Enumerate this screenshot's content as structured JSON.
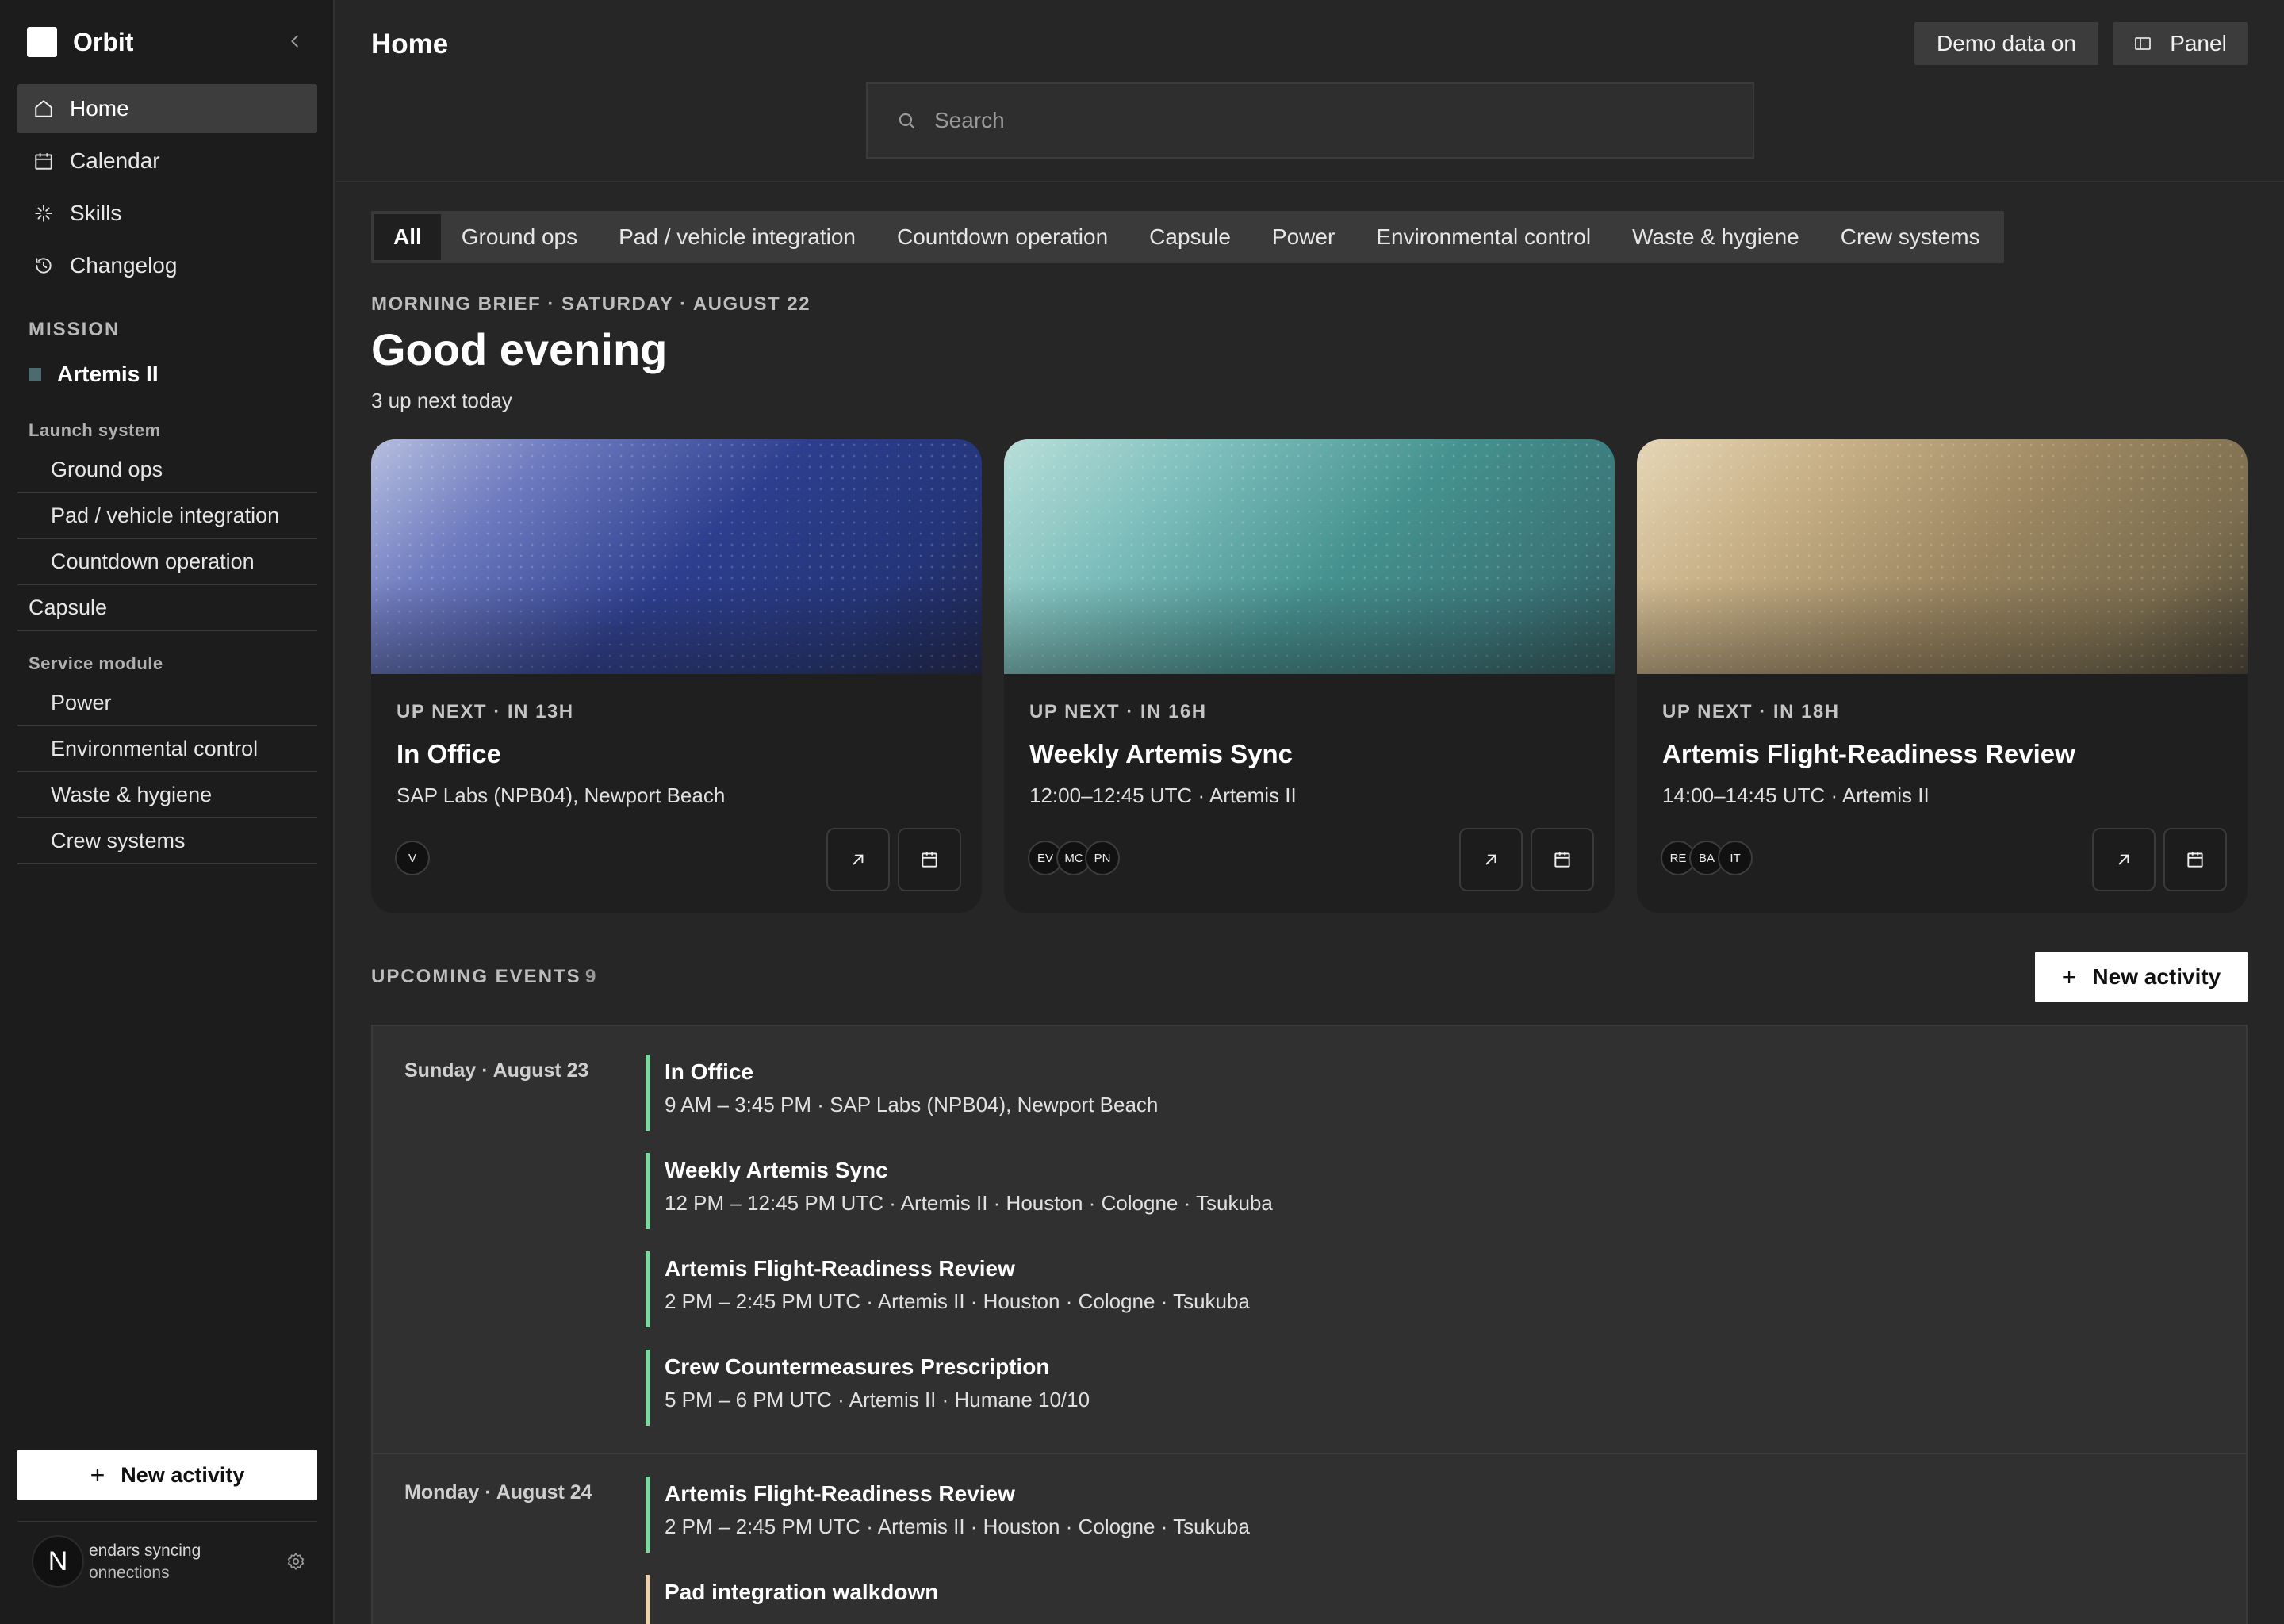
{
  "app": {
    "name": "Orbit"
  },
  "sidebar": {
    "nav": [
      {
        "label": "Home",
        "icon": "home-icon",
        "active": true
      },
      {
        "label": "Calendar",
        "icon": "calendar-icon",
        "active": false
      },
      {
        "label": "Skills",
        "icon": "skills-icon",
        "active": false
      },
      {
        "label": "Changelog",
        "icon": "history-icon",
        "active": false
      }
    ],
    "mission_label": "MISSION",
    "mission": {
      "name": "Artemis II",
      "color": "#4d6b6f"
    },
    "groups": [
      {
        "label": "Launch system",
        "items": [
          "Ground ops",
          "Pad / vehicle integration",
          "Countdown operation"
        ]
      },
      {
        "label": "Capsule",
        "items": []
      },
      {
        "label": "Service module",
        "items": [
          "Power",
          "Environmental control",
          "Waste & hygiene",
          "Crew systems"
        ]
      }
    ],
    "new_activity": "New activity",
    "sync": {
      "avatar_letter": "N",
      "line1": "endars syncing",
      "line2": "onnections"
    }
  },
  "header": {
    "title": "Home",
    "demo_button": "Demo data on",
    "panel_button": "Panel",
    "search_placeholder": "Search"
  },
  "tabs": [
    "All",
    "Ground ops",
    "Pad / vehicle integration",
    "Countdown operation",
    "Capsule",
    "Power",
    "Environmental control",
    "Waste & hygiene",
    "Crew systems"
  ],
  "active_tab": "All",
  "brief": {
    "label": "MORNING BRIEF · SATURDAY · AUGUST 22",
    "greeting": "Good evening",
    "summary": "3 up next today"
  },
  "cards": [
    {
      "kicker": "UP NEXT · IN 13H",
      "title": "In Office",
      "sub": "SAP Labs (NPB04), Newport Beach",
      "avatars": [
        "V"
      ],
      "theme": "navy"
    },
    {
      "kicker": "UP NEXT · IN 16H",
      "title": "Weekly Artemis Sync",
      "sub": "12:00–12:45 UTC · Artemis II",
      "avatars": [
        "EV",
        "MC",
        "PN"
      ],
      "theme": "teal"
    },
    {
      "kicker": "UP NEXT · IN 18H",
      "title": "Artemis Flight-Readiness Review",
      "sub": "14:00–14:45 UTC · Artemis II",
      "avatars": [
        "RE",
        "BA",
        "IT"
      ],
      "theme": "gold"
    }
  ],
  "upcoming": {
    "label": "UPCOMING EVENTS",
    "count": "9",
    "new_activity": "New activity",
    "days": [
      {
        "label": "Sunday · August 23",
        "events": [
          {
            "title": "In Office",
            "meta": "9 AM – 3:45 PM · SAP Labs (NPB04), Newport Beach",
            "color": "#7ed6a0"
          },
          {
            "title": "Weekly Artemis Sync",
            "meta": "12 PM – 12:45 PM UTC · Artemis II · Houston · Cologne · Tsukuba",
            "color": "#7ed6a0"
          },
          {
            "title": "Artemis Flight-Readiness Review",
            "meta": "2 PM – 2:45 PM UTC · Artemis II · Houston · Cologne · Tsukuba",
            "color": "#7ed6a0"
          },
          {
            "title": "Crew Countermeasures Prescription",
            "meta": "5 PM – 6 PM UTC · Artemis II · Humane 10/10",
            "color": "#7ed6a0"
          }
        ]
      },
      {
        "label": "Monday · August 24",
        "events": [
          {
            "title": "Artemis Flight-Readiness Review",
            "meta": "2 PM – 2:45 PM UTC · Artemis II · Houston · Cologne · Tsukuba",
            "color": "#7ed6a0"
          },
          {
            "title": "Pad integration walkdown",
            "meta": "",
            "color": "#e8d2b0"
          }
        ]
      }
    ]
  }
}
